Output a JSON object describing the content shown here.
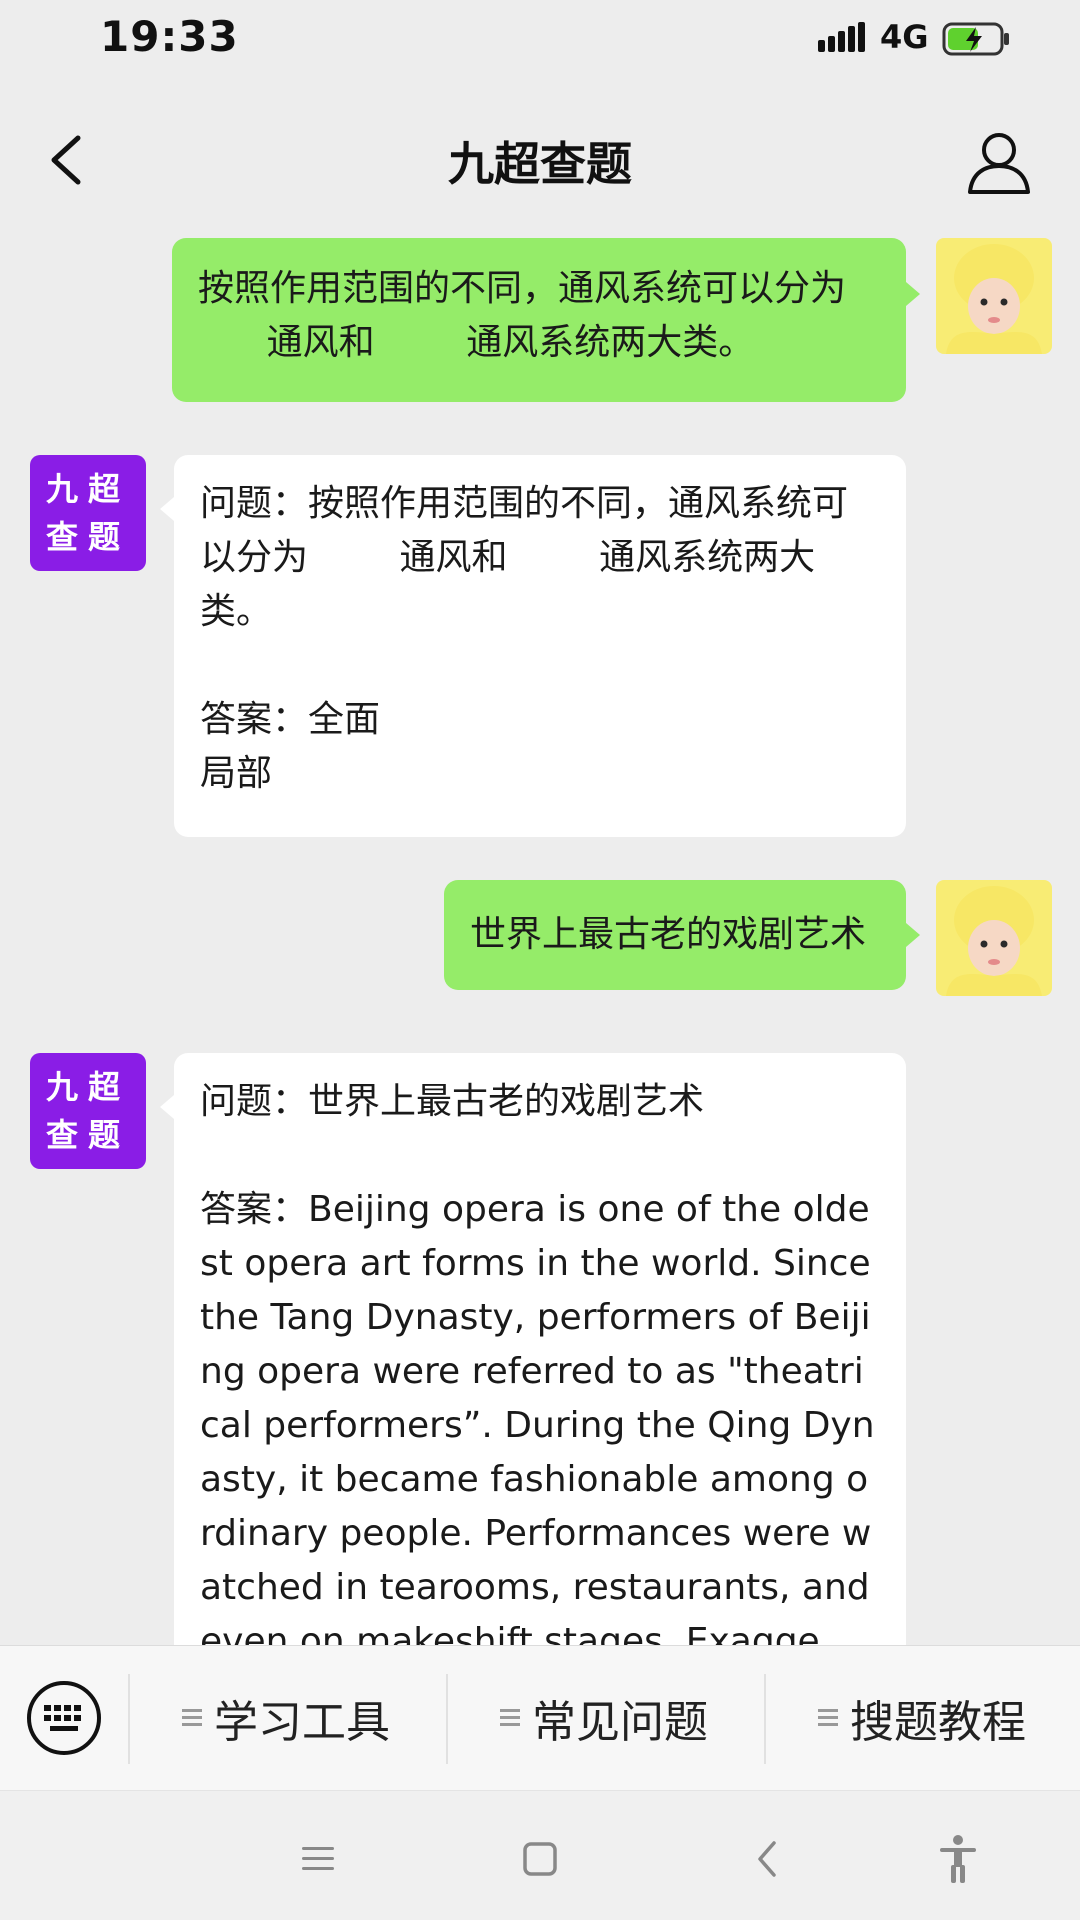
{
  "status_bar": {
    "time": "19:33",
    "network": "4G"
  },
  "header": {
    "title": "九超查题"
  },
  "bot_avatar": {
    "line1": "九超",
    "line2": "查题"
  },
  "messages": {
    "m1": {
      "text": "按照作用范围的不同，通风系统可以分为\n      通风和        通风系统两大类。"
    },
    "m2": {
      "text": "问题：按照作用范围的不同，通风系统可以分为        通风和        通风系统两大类。\n\n答案：全面\n局部"
    },
    "m3": {
      "text": "世界上最古老的戏剧艺术"
    },
    "m4": {
      "text": "问题：世界上最古老的戏剧艺术\n\n答案：Beijing opera is one of the oldest opera art forms in the world. Since the Tang Dynasty, performers of Beijing opera were referred to as \"theatrical performers”. During the Qing Dynasty, it became fashionable among ordinary people. Performances were watched in tearooms, restaurants, and even on makeshift stages. Exagge"
    }
  },
  "menu": {
    "items": [
      {
        "label": "学习工具"
      },
      {
        "label": "常见问题"
      },
      {
        "label": "搜题教程"
      }
    ]
  },
  "colors": {
    "sent_bubble": "#95ec69",
    "received_bubble": "#ffffff",
    "bot_avatar": "#8a1de6",
    "background": "#ededed"
  },
  "icons": {
    "back": "chevron-left-icon",
    "profile": "person-icon",
    "keyboard": "keyboard-icon",
    "menu": "menu-lines-icon"
  }
}
